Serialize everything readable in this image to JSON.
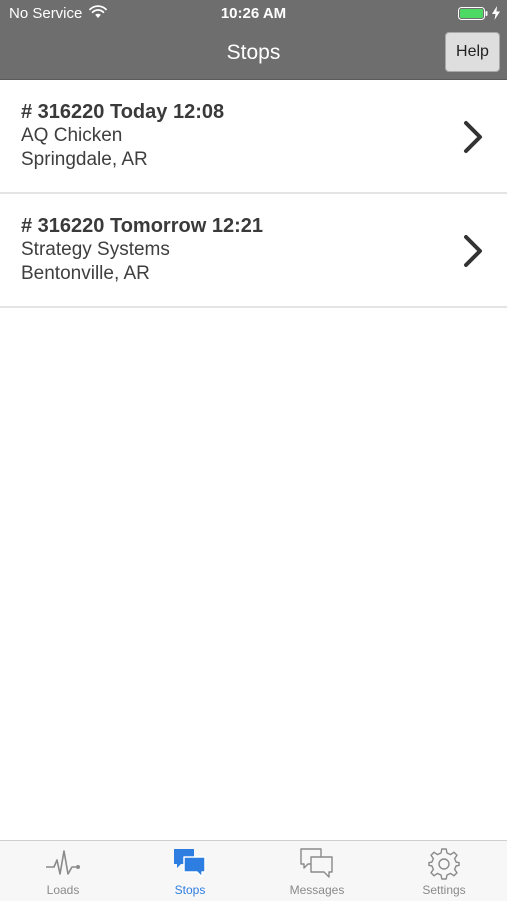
{
  "status_bar": {
    "carrier": "No Service",
    "time": "10:26 AM",
    "battery_color": "#4cd964"
  },
  "nav": {
    "title": "Stops",
    "help_label": "Help"
  },
  "stops": [
    {
      "title": "# 316220 Today 12:08",
      "name": "AQ Chicken",
      "location": "Springdale, AR"
    },
    {
      "title": "# 316220 Tomorrow 12:21",
      "name": "Strategy Systems",
      "location": "Bentonville, AR"
    }
  ],
  "tabs": [
    {
      "label": "Loads",
      "icon": "pulse-icon",
      "active": false
    },
    {
      "label": "Stops",
      "icon": "chat-bubbles-icon",
      "active": true
    },
    {
      "label": "Messages",
      "icon": "messages-icon",
      "active": false
    },
    {
      "label": "Settings",
      "icon": "gear-icon",
      "active": false
    }
  ],
  "colors": {
    "header_background": "#6e6e6e",
    "tab_active": "#2e7de1",
    "tab_inactive": "#8a8a8a"
  }
}
